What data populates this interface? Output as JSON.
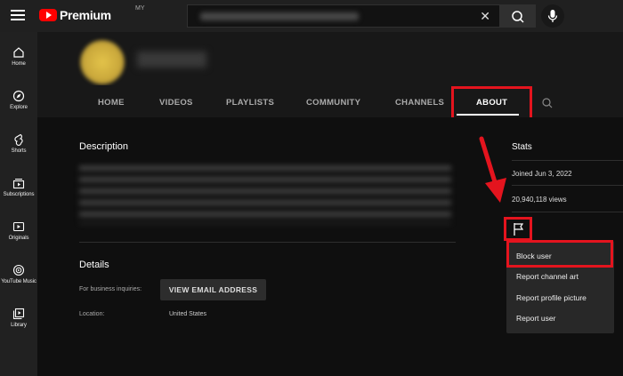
{
  "topbar": {
    "logo_text": "Premium",
    "logo_sup": "MY",
    "search_clear": "✕"
  },
  "sidebar": {
    "items": [
      {
        "label": "Home",
        "icon": "home-icon"
      },
      {
        "label": "Explore",
        "icon": "compass-icon"
      },
      {
        "label": "Shorts",
        "icon": "shorts-icon"
      },
      {
        "label": "Subscriptions",
        "icon": "subscriptions-icon"
      },
      {
        "label": "Originals",
        "icon": "originals-icon"
      },
      {
        "label": "YouTube Music",
        "icon": "music-icon"
      },
      {
        "label": "Library",
        "icon": "library-icon"
      }
    ]
  },
  "tabs": [
    "HOME",
    "VIDEOS",
    "PLAYLISTS",
    "COMMUNITY",
    "CHANNELS",
    "ABOUT"
  ],
  "active_tab": "ABOUT",
  "about": {
    "description_title": "Description",
    "details_title": "Details",
    "business_label": "For business inquiries:",
    "email_button": "VIEW EMAIL ADDRESS",
    "location_label": "Location:",
    "location_value": "United States"
  },
  "stats": {
    "title": "Stats",
    "joined": "Joined Jun 3, 2022",
    "views": "20,940,118 views"
  },
  "report_menu": {
    "items": [
      "Block user",
      "Report channel art",
      "Report profile picture",
      "Report user"
    ]
  },
  "colors": {
    "highlight": "#e4141e",
    "brand": "#ff0000"
  }
}
